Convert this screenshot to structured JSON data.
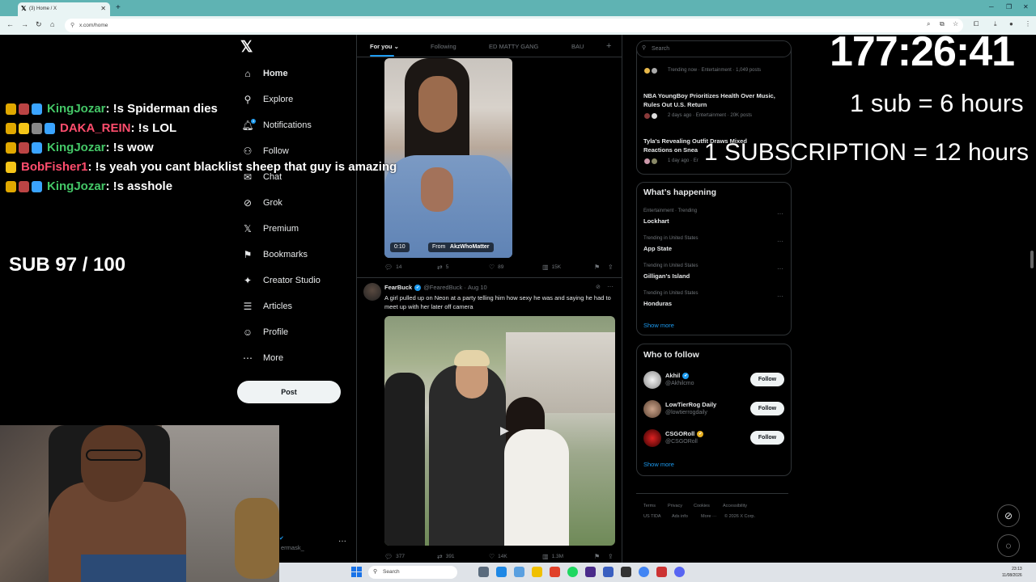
{
  "browser": {
    "tab_title": "(3) Home / X",
    "url": "x.com/home"
  },
  "nav": {
    "items": [
      {
        "label": "Home",
        "icon": "home-icon"
      },
      {
        "label": "Explore",
        "icon": "search-icon"
      },
      {
        "label": "Notifications",
        "icon": "bell-icon"
      },
      {
        "label": "Follow",
        "icon": "follow-icon"
      },
      {
        "label": "Chat",
        "icon": "chat-icon"
      },
      {
        "label": "Grok",
        "icon": "grok-icon"
      },
      {
        "label": "Premium",
        "icon": "x-premium-icon"
      },
      {
        "label": "Bookmarks",
        "icon": "bookmark-icon"
      },
      {
        "label": "Creator Studio",
        "icon": "creator-studio-icon"
      },
      {
        "label": "Articles",
        "icon": "articles-icon"
      },
      {
        "label": "Profile",
        "icon": "profile-icon"
      },
      {
        "label": "More",
        "icon": "more-icon"
      }
    ],
    "notification_count": "3",
    "post_label": "Post",
    "account_handle": "ermask_"
  },
  "timeline": {
    "tabs": [
      "For you",
      "Following",
      "ED MATTY GANG",
      "BAU"
    ],
    "tweet1": {
      "video_time": "0:10",
      "from_label": "From",
      "from_handle": "AkzWhoMatter",
      "replies": "14",
      "reposts": "5",
      "likes": "89",
      "views": "15K"
    },
    "tweet2": {
      "name": "FearBuck",
      "handle": "@FearedBuck",
      "date": "Aug 10",
      "text": "A girl pulled up on Neon at a party telling him how sexy he was and saying he had to meet up with her later off camera",
      "replies": "377",
      "reposts": "391",
      "likes": "14K",
      "views": "1.3M"
    }
  },
  "sidebar": {
    "search_placeholder": "Search",
    "news": [
      {
        "meta": "Trending now · Entertainment · 1,049 posts",
        "title": ""
      },
      {
        "title": "NBA YoungBoy Prioritizes Health Over Music, Rules Out U.S. Return",
        "meta": "2 days ago · Entertainment · 20K posts"
      },
      {
        "title": "Tyla's Revealing Outfit Draws Mixed Reactions on Snea",
        "meta": "1 day ago · Er"
      }
    ],
    "happening_title": "What’s happening",
    "trends": [
      {
        "meta": "Entertainment · Trending",
        "title": "Lockhart"
      },
      {
        "meta": "Trending in United States",
        "title": "App State"
      },
      {
        "meta": "Trending in United States",
        "title": "Gilligan's Island"
      },
      {
        "meta": "Trending in United States",
        "title": "Honduras"
      }
    ],
    "show_more": "Show more",
    "who_to_follow_title": "Who to follow",
    "who_to_follow": [
      {
        "name": "Akhil",
        "handle": "@Akhilcmo",
        "button": "Follow"
      },
      {
        "name": "LowTierRog Daily",
        "handle": "@lowtierrogdaily",
        "button": "Follow"
      },
      {
        "name": "CSGORoll",
        "handle": "@CSGORoll",
        "button": "Follow"
      }
    ],
    "footer_links": [
      "Terms",
      "Privacy",
      "Cookies",
      "Accessibility",
      "US TIDA",
      "Ads info",
      "More ···",
      "© 2026 X Corp."
    ]
  },
  "overlay": {
    "chat": [
      {
        "user": "KingJozar",
        "message": ": !s Spiderman dies"
      },
      {
        "user": "DAKA_REIN",
        "message": ": !s LOL"
      },
      {
        "user": "KingJozar",
        "message": ": !s wow"
      },
      {
        "user": "BobFisher1",
        "message": ": !s yeah you cant blacklist sheep that guy is amazing"
      },
      {
        "user": "KingJozar",
        "message": ": !s asshole"
      }
    ],
    "sub_counter": "SUB 97 / 100",
    "timer": "177:26:41",
    "sub_rule": "1 sub = 6 hours",
    "sub_rule2": "1 SUBSCRIPTION = 12 hours"
  },
  "taskbar": {
    "search_placeholder": "Search",
    "time": "23:13",
    "date": "11/08/2026"
  }
}
